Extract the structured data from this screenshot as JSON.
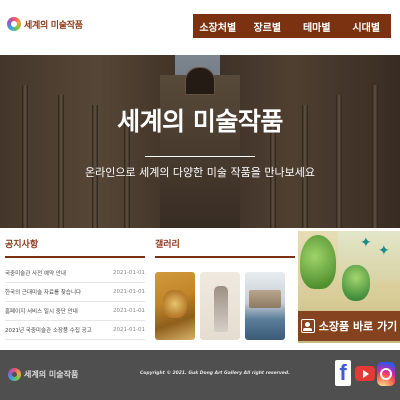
{
  "header": {
    "logo_text": "세계의 미술작품",
    "nav": [
      "소장처별",
      "장르별",
      "테마별",
      "시대별"
    ]
  },
  "hero": {
    "title": "세계의 미술작품",
    "subtitle": "온라인으로 세계의 다양한 미술 작품을 만나보세요"
  },
  "notice": {
    "title": "공지사항",
    "items": [
      {
        "title": "국중미술관 사전 예약 안내",
        "date": "2021-01-01"
      },
      {
        "title": "한국의 근대미술 자료를 찾습니다",
        "date": "2021-01-01"
      },
      {
        "title": "홈페이지 서비스 일시 중단 안내",
        "date": "2021-01-01"
      },
      {
        "title": "2021년 국중미술관 소장품 수집 공고",
        "date": "2021-01-01"
      }
    ]
  },
  "gallery": {
    "title": "갤러리"
  },
  "promo": {
    "label": "소장품 바로 가기"
  },
  "footer": {
    "logo_text": "세계의 미술작품",
    "copyright": "Copyright © 2021. Guk Dong Art Gallery All right reserved."
  },
  "colors": {
    "brand": "#7a3210",
    "footer_bg": "#4f4f4f"
  }
}
